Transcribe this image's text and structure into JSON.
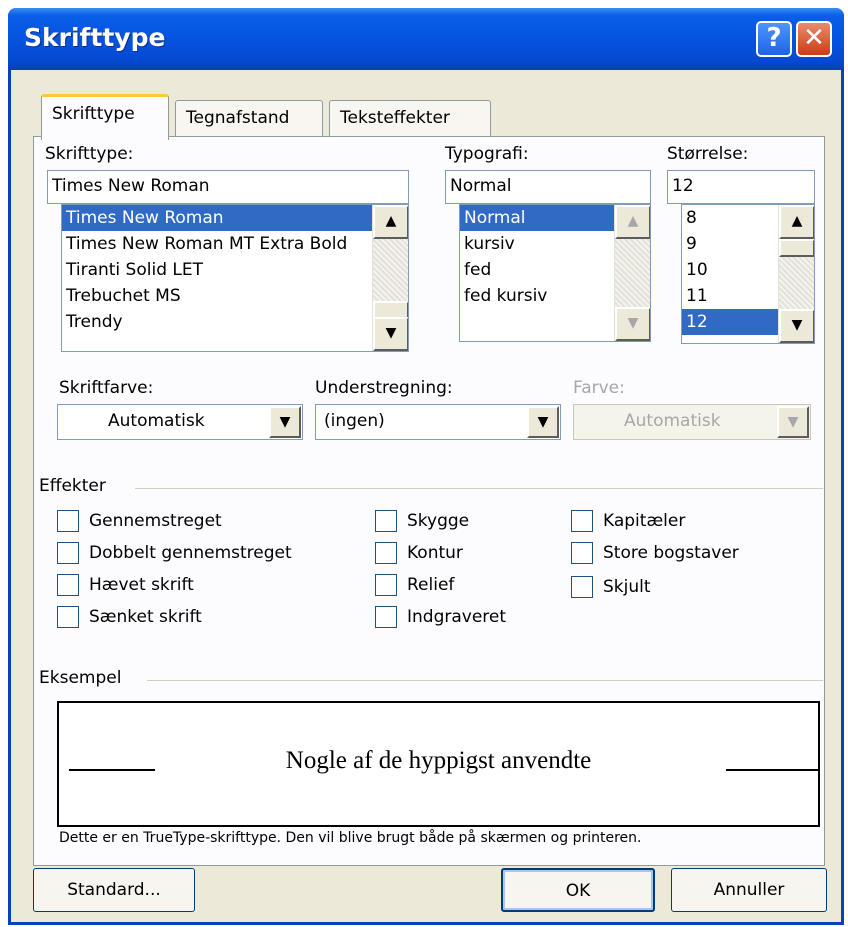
{
  "window": {
    "title": "Skrifttype"
  },
  "titlebar_buttons": {
    "help": "?",
    "close": "✕"
  },
  "tabs": [
    {
      "label": "Skrifttype",
      "active": true
    },
    {
      "label": "Tegnafstand",
      "active": false
    },
    {
      "label": "Teksteffekter",
      "active": false
    }
  ],
  "font": {
    "label": "Skrifttype:",
    "value": "Times New Roman",
    "items": [
      "Times New Roman",
      "Times New Roman MT Extra Bold",
      "Tiranti Solid LET",
      "Trebuchet MS",
      "Trendy"
    ]
  },
  "style": {
    "label": "Typografi:",
    "value": "Normal",
    "items": [
      "Normal",
      "kursiv",
      "fed",
      "fed kursiv"
    ]
  },
  "size": {
    "label": "Størrelse:",
    "value": "12",
    "items": [
      "8",
      "9",
      "10",
      "11",
      "12"
    ]
  },
  "font_color": {
    "label": "Skriftfarve:",
    "value": "Automatisk"
  },
  "underline": {
    "label": "Understregning:",
    "value": "(ingen)"
  },
  "underline_color": {
    "label": "Farve:",
    "value": "Automatisk"
  },
  "effects": {
    "group_label": "Effekter",
    "col1": [
      "Gennemstreget",
      "Dobbelt gennemstreget",
      "Hævet skrift",
      "Sænket skrift"
    ],
    "col2": [
      "Skygge",
      "Kontur",
      "Relief",
      "Indgraveret"
    ],
    "col3": [
      "Kapitæler",
      "Store bogstaver",
      "Skjult"
    ]
  },
  "preview": {
    "group_label": "Eksempel",
    "text": "Nogle af de hyppigst anvendte",
    "note": "Dette er en TrueType-skrifttype. Den vil blive brugt både på skærmen og printeren."
  },
  "buttons": {
    "default": "Standard...",
    "ok": "OK",
    "cancel": "Annuller"
  },
  "icons": {
    "scroll_up": "▲",
    "scroll_down": "▼",
    "dropdown": "▼"
  },
  "colors": {
    "titlebar": "#0653e0",
    "dialog_bg": "#ece9d8",
    "selection": "#316ac5"
  }
}
